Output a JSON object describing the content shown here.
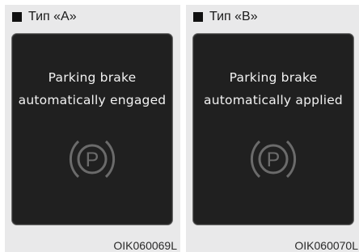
{
  "panels": [
    {
      "type_label": "Тип «A»",
      "message_line1": "Parking brake",
      "message_line2": "automatically engaged",
      "indicator_letter": "P",
      "image_code": "OIK060069L"
    },
    {
      "type_label": "Тип «B»",
      "message_line1": "Parking brake",
      "message_line2": "automatically applied",
      "indicator_letter": "P",
      "image_code": "OIK060070L"
    }
  ],
  "colors": {
    "panel_bg": "#e9e9ea",
    "screen_bg": "#202020",
    "icon_gray": "#6b6b6b"
  }
}
